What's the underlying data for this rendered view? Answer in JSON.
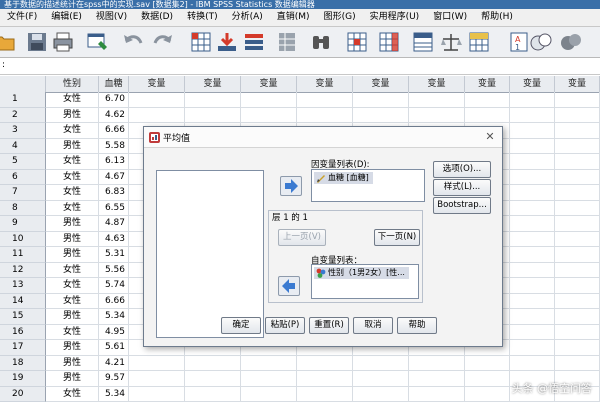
{
  "window": {
    "title": "基于数据的描述统计在spss中的实现.sav [数据集2] - IBM SPSS Statistics 数据编辑器"
  },
  "menu": [
    "文件(F)",
    "编辑(E)",
    "视图(V)",
    "数据(D)",
    "转换(T)",
    "分析(A)",
    "直销(M)",
    "图形(G)",
    "实用程序(U)",
    "窗口(W)",
    "帮助(H)"
  ],
  "cell_ref": ":",
  "grid": {
    "columns": [
      "性别",
      "血糖",
      "变量",
      "变量",
      "变量",
      "变量",
      "变量",
      "变量",
      "变量",
      "变量",
      "变量",
      "变量"
    ],
    "rows": [
      {
        "n": "1",
        "sex": "女性",
        "val": "6.70"
      },
      {
        "n": "2",
        "sex": "男性",
        "val": "4.62"
      },
      {
        "n": "3",
        "sex": "女性",
        "val": "6.66"
      },
      {
        "n": "4",
        "sex": "男性",
        "val": "5.58"
      },
      {
        "n": "5",
        "sex": "女性",
        "val": "6.13"
      },
      {
        "n": "6",
        "sex": "女性",
        "val": "4.67"
      },
      {
        "n": "7",
        "sex": "女性",
        "val": "6.83"
      },
      {
        "n": "8",
        "sex": "女性",
        "val": "6.55"
      },
      {
        "n": "9",
        "sex": "男性",
        "val": "4.87"
      },
      {
        "n": "10",
        "sex": "男性",
        "val": "4.63"
      },
      {
        "n": "11",
        "sex": "男性",
        "val": "5.31"
      },
      {
        "n": "12",
        "sex": "女性",
        "val": "5.56"
      },
      {
        "n": "13",
        "sex": "女性",
        "val": "5.74"
      },
      {
        "n": "14",
        "sex": "女性",
        "val": "6.66"
      },
      {
        "n": "15",
        "sex": "男性",
        "val": "5.34"
      },
      {
        "n": "16",
        "sex": "女性",
        "val": "4.95"
      },
      {
        "n": "17",
        "sex": "男性",
        "val": "5.61"
      },
      {
        "n": "18",
        "sex": "男性",
        "val": "4.21"
      },
      {
        "n": "19",
        "sex": "男性",
        "val": "9.57"
      },
      {
        "n": "20",
        "sex": "女性",
        "val": "5.34"
      }
    ]
  },
  "dialog": {
    "title": "平均值",
    "dependent_label": "因变量列表(D):",
    "dependent_item": "血糖 [血糖]",
    "layer_label": "层 1 的 1",
    "prev_button": "上一页(V)",
    "next_button": "下一页(N)",
    "independent_label": "自变量列表：",
    "independent_item": "性别（1男2女）[性...",
    "options_button": "选项(O)...",
    "style_button": "样式(L)...",
    "bootstrap_button": "Bootstrap...",
    "ok_button": "确定",
    "paste_button": "粘贴(P)",
    "reset_button": "重置(R)",
    "cancel_button": "取消",
    "help_button": "帮助"
  },
  "watermark": "头条 @悟空问答",
  "colors": {
    "title_bar": "#3a6fa8",
    "grid_header": "#e9ecf0",
    "selected_item": "#d6dbe6"
  }
}
